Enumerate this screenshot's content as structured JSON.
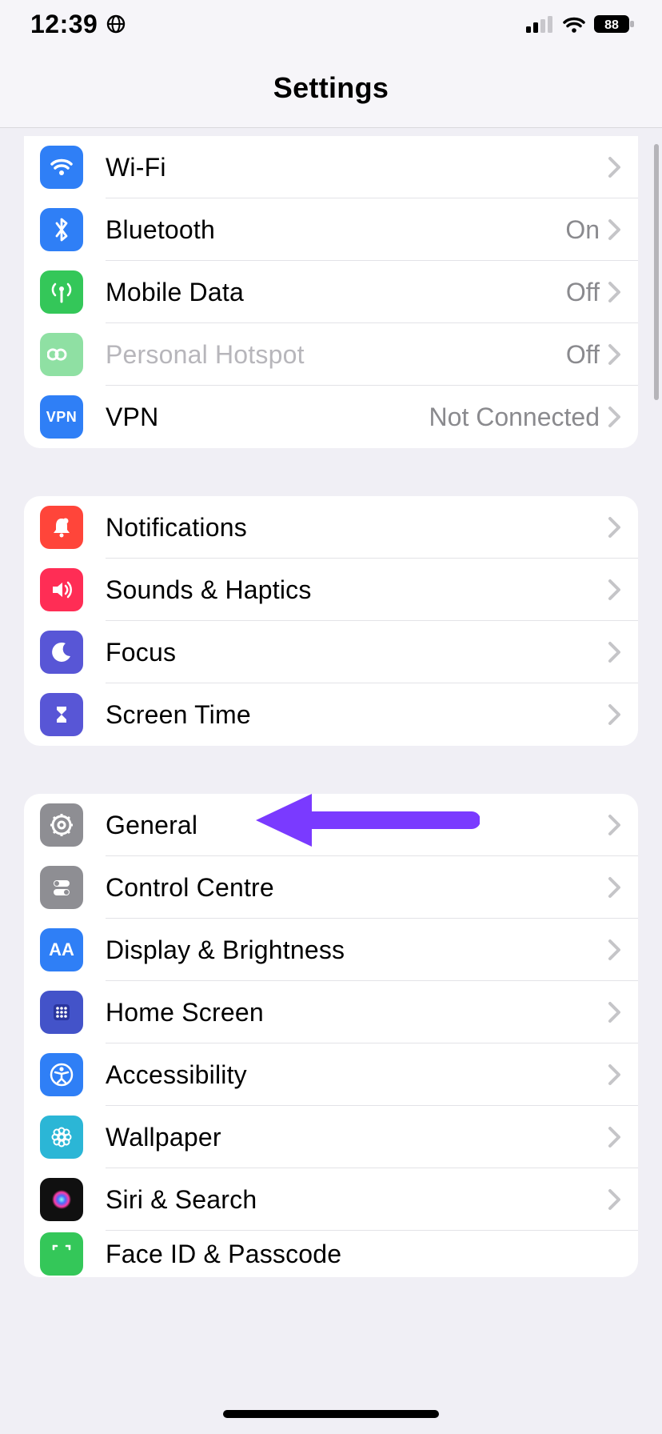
{
  "status": {
    "time": "12:39",
    "battery": "88"
  },
  "header": {
    "title": "Settings"
  },
  "groups": [
    {
      "rows": [
        {
          "icon": "wifi-icon",
          "iconBg": "#2f7ff6",
          "label": "Wi-Fi",
          "value": "",
          "disabled": false
        },
        {
          "icon": "bluetooth-icon",
          "iconBg": "#2f7ff6",
          "label": "Bluetooth",
          "value": "On",
          "disabled": false
        },
        {
          "icon": "antenna-icon",
          "iconBg": "#34c759",
          "label": "Mobile Data",
          "value": "Off",
          "disabled": false
        },
        {
          "icon": "link-icon",
          "iconBg": "#34c759",
          "label": "Personal Hotspot",
          "value": "Off",
          "disabled": true
        },
        {
          "icon": "vpn-icon",
          "iconBg": "#2f7ff6",
          "label": "VPN",
          "value": "Not Connected",
          "disabled": false
        }
      ]
    },
    {
      "rows": [
        {
          "icon": "bell-icon",
          "iconBg": "#ff453a",
          "label": "Notifications",
          "value": "",
          "disabled": false
        },
        {
          "icon": "speaker-icon",
          "iconBg": "#ff2d55",
          "label": "Sounds & Haptics",
          "value": "",
          "disabled": false
        },
        {
          "icon": "moon-icon",
          "iconBg": "#5856d6",
          "label": "Focus",
          "value": "",
          "disabled": false
        },
        {
          "icon": "hourglass-icon",
          "iconBg": "#5856d6",
          "label": "Screen Time",
          "value": "",
          "disabled": false
        }
      ]
    },
    {
      "rows": [
        {
          "icon": "gear-icon",
          "iconBg": "#8e8e93",
          "label": "General",
          "value": "",
          "disabled": false
        },
        {
          "icon": "toggles-icon",
          "iconBg": "#8e8e93",
          "label": "Control Centre",
          "value": "",
          "disabled": false
        },
        {
          "icon": "aa-icon",
          "iconBg": "#2f7ff6",
          "label": "Display & Brightness",
          "value": "",
          "disabled": false
        },
        {
          "icon": "grid-icon",
          "iconBg": "#4353c9",
          "label": "Home Screen",
          "value": "",
          "disabled": false
        },
        {
          "icon": "accessibility-icon",
          "iconBg": "#2f7ff6",
          "label": "Accessibility",
          "value": "",
          "disabled": false
        },
        {
          "icon": "flower-icon",
          "iconBg": "#2bb6d6",
          "label": "Wallpaper",
          "value": "",
          "disabled": false
        },
        {
          "icon": "siri-icon",
          "iconBg": "#101010",
          "label": "Siri & Search",
          "value": "",
          "disabled": false
        },
        {
          "icon": "faceid-icon",
          "iconBg": "#34c759",
          "label": "Face ID & Passcode",
          "value": "",
          "disabled": false
        }
      ]
    }
  ],
  "annotation": {
    "target": "General",
    "color": "#7a3aff"
  }
}
